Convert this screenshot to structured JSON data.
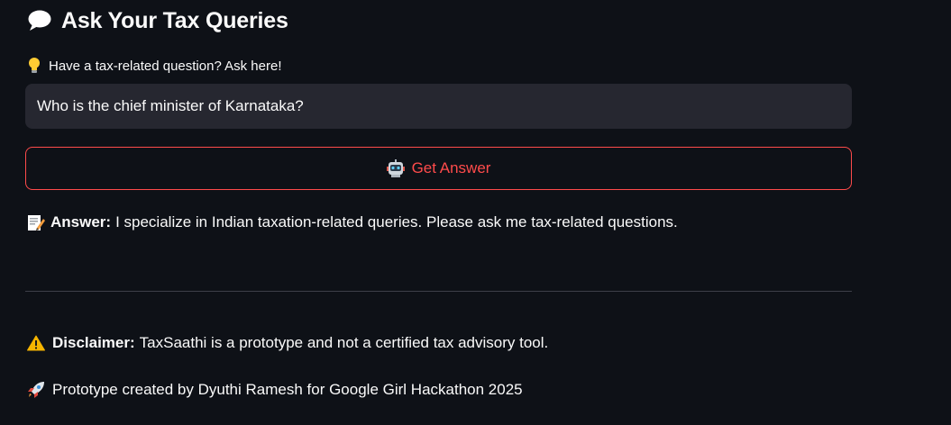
{
  "header": {
    "icon": "speech-bubble-icon",
    "title": "Ask Your Tax Queries"
  },
  "prompt": {
    "icon": "lightbulb-icon",
    "label": "Have a tax-related question? Ask here!"
  },
  "question_input": {
    "value": "Who is the chief minister of Karnataka?"
  },
  "get_answer_button": {
    "icon": "robot-icon",
    "label": "Get Answer",
    "color": "#ff4b4b"
  },
  "answer": {
    "icon": "memo-icon",
    "label": "Answer:",
    "text": "I specialize in Indian taxation-related queries. Please ask me tax-related questions."
  },
  "disclaimer": {
    "icon": "warning-icon",
    "label": "Disclaimer:",
    "text": "TaxSaathi is a prototype and not a certified tax advisory tool."
  },
  "credit": {
    "icon": "rocket-icon",
    "text": "Prototype created by Dyuthi Ramesh for Google Girl Hackathon 2025"
  },
  "colors": {
    "background": "#0e1117",
    "input_background": "#262730",
    "accent": "#ff4b4b",
    "text": "#fafafa"
  }
}
